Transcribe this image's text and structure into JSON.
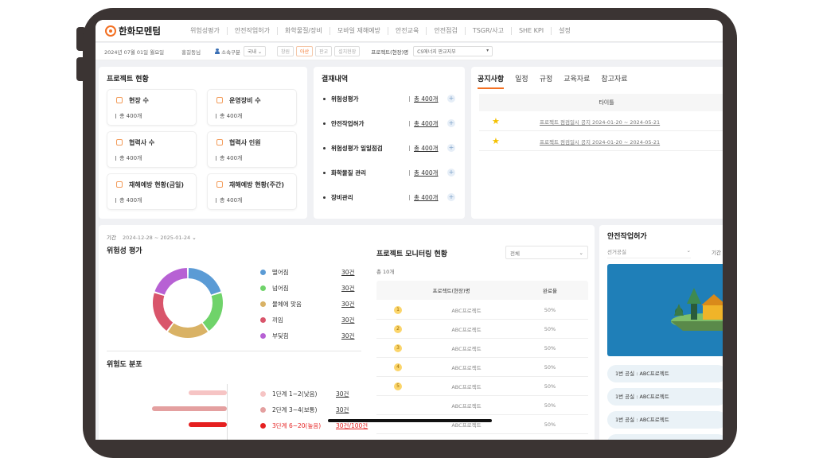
{
  "app": {
    "logo_text": "한화모멘텀"
  },
  "nav": {
    "items": [
      "위험성평가",
      "안전작업허가",
      "화학물질/장비",
      "모바일 재해예방",
      "안전교육",
      "안전점검",
      "TSGR/사고",
      "SHE KPI",
      "설정"
    ]
  },
  "subbar": {
    "date": "2024년 07월 01일 월요일",
    "user": "홍길동님",
    "affiliation_label": "소속구분",
    "affiliation_value": "국내",
    "sites": [
      "창원",
      "아산",
      "판교",
      "설치현장"
    ],
    "active_site": "아산",
    "project_label": "프로젝트(현장)명",
    "project_value": "CS에너지 판교지부"
  },
  "project_status": {
    "title": "프로젝트 현황",
    "stats": [
      {
        "label": "현장 수",
        "value": "총 400개",
        "icon": "location-icon"
      },
      {
        "label": "운영장비 수",
        "value": "총 400개",
        "icon": "equipment-icon"
      },
      {
        "label": "협력사 수",
        "value": "총 400개",
        "icon": "company-icon"
      },
      {
        "label": "협력사 인원",
        "value": "총 400개",
        "icon": "workers-icon"
      },
      {
        "label": "재해예방 현황(금일)",
        "value": "총 400개",
        "icon": "prevention-icon"
      },
      {
        "label": "재해예방 현황(주간)",
        "value": "총 400개",
        "icon": "calendar-icon"
      }
    ]
  },
  "approvals": {
    "title": "결재내역",
    "items": [
      {
        "label": "위험성평가",
        "count": "총 400개"
      },
      {
        "label": "안전작업허가",
        "count": "총 400개"
      },
      {
        "label": "위험성평가 일일점검",
        "count": "총 400개"
      },
      {
        "label": "화학물질 관리",
        "count": "총 400개"
      },
      {
        "label": "장비관리",
        "count": "총 400개"
      }
    ]
  },
  "notices": {
    "tabs": [
      "공지사항",
      "일정",
      "규정",
      "교육자료",
      "참고자료"
    ],
    "active_tab": "공지사항",
    "column": "타이틀",
    "rows": [
      {
        "text": "프로젝트 점검일시 공지   2024-01-20 ~ 2024-05-21"
      },
      {
        "text": "프로젝트 점검일시 공지   2024-01-20 ~ 2024-05-21"
      }
    ]
  },
  "period": {
    "label": "기간",
    "value": "2024-12-28 ~ 2025-01-24"
  },
  "risk_assessment": {
    "title": "위험성 평가",
    "items": [
      {
        "name": "떨어짐",
        "count": "30건",
        "color": "#5b9bd5"
      },
      {
        "name": "넘어짐",
        "count": "30건",
        "color": "#6fd36a"
      },
      {
        "name": "물체에 맞음",
        "count": "30건",
        "color": "#d9b265"
      },
      {
        "name": "끼임",
        "count": "30건",
        "color": "#d9556b"
      },
      {
        "name": "부딪힘",
        "count": "30건",
        "color": "#b761d4"
      }
    ]
  },
  "chart_data": {
    "type": "pie",
    "categories": [
      "떨어짐",
      "넘어짐",
      "물체에 맞음",
      "끼임",
      "부딪힘"
    ],
    "values": [
      30,
      30,
      30,
      30,
      30
    ]
  },
  "risk_distribution": {
    "title": "위험도 분포",
    "items": [
      {
        "name": "1단계 1~2(낮음)",
        "count": "30건",
        "color": "#f6c4c4",
        "fraction": 0.4
      },
      {
        "name": "2단계 3~4(보통)",
        "count": "30건",
        "color": "#e4a0a0",
        "fraction": 0.75
      },
      {
        "name": "3단계 6~20(높음)",
        "count": "30건/100건",
        "color": "#e52020",
        "fraction": 0.4
      }
    ]
  },
  "monitoring": {
    "title": "프로젝트 모니터링 현황",
    "filter": "전체",
    "total": "총 10개",
    "headers": [
      "프로젝트(현장)명",
      "완료율"
    ],
    "rows": [
      {
        "num": "1",
        "name": "ABC프로젝트",
        "rate": "50%"
      },
      {
        "num": "2",
        "name": "ABC프로젝트",
        "rate": "50%"
      },
      {
        "num": "3",
        "name": "ABC프로젝트",
        "rate": "50%"
      },
      {
        "num": "4",
        "name": "ABC프로젝트",
        "rate": "50%"
      },
      {
        "num": "5",
        "name": "ABC프로젝트",
        "rate": "50%"
      },
      {
        "num": "",
        "name": "ABC프로젝트",
        "rate": "50%"
      },
      {
        "num": "",
        "name": "ABC프로젝트",
        "rate": "50%"
      }
    ]
  },
  "work_permit": {
    "title": "안전작업허가",
    "select": "선거공실",
    "period_label": "기간",
    "items": [
      "1번 공실 : ABC프로젝트",
      "1번 공실 : ABC프로젝트",
      "1번 공실 : ABC프로젝트"
    ]
  }
}
